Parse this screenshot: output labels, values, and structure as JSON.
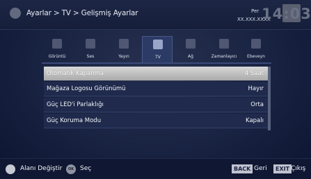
{
  "header": {
    "breadcrumb": "Ayarlar > TV > Gelişmiş Ayarlar",
    "day": "Per",
    "date": "XX.XXX.XXXX",
    "time": "14:03"
  },
  "tabs": [
    {
      "label": "Görüntü",
      "icon": "picture-icon"
    },
    {
      "label": "Ses",
      "icon": "speaker-icon"
    },
    {
      "label": "Yayın",
      "icon": "antenna-icon"
    },
    {
      "label": "TV",
      "icon": "tv-icon",
      "active": true
    },
    {
      "label": "Ağ",
      "icon": "globe-icon"
    },
    {
      "label": "Zamanlayıcı",
      "icon": "clock-icon"
    },
    {
      "label": "Ebeveyn",
      "icon": "parental-icon"
    }
  ],
  "menu": [
    {
      "label": "Otomatik Kapanma",
      "value": "4 Saat",
      "selected": true
    },
    {
      "label": "Mağaza Logosu Görünümü",
      "value": "Hayır"
    },
    {
      "label": "Güç LED'i Parlaklığı",
      "value": "Orta"
    },
    {
      "label": "Güç Koruma Modu",
      "value": "Kapalı"
    }
  ],
  "footer": {
    "move_label": "Alanı Değiştir",
    "ok_key": "OK",
    "select_label": "Seç",
    "back_key": "BACK",
    "back_label": "Geri",
    "exit_key": "EXIT",
    "exit_label": "Çıkış"
  }
}
